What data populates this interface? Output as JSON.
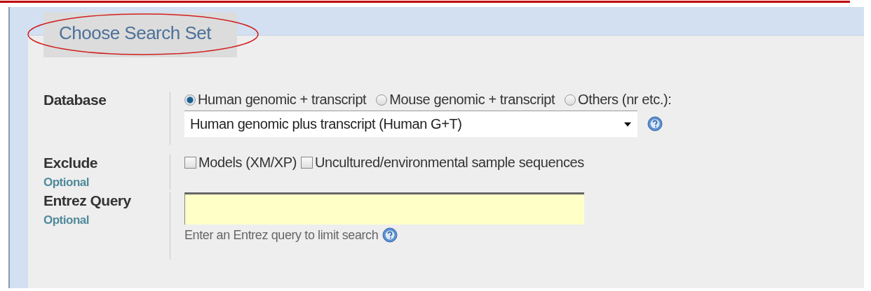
{
  "section": {
    "title": "Choose Search Set",
    "title_circled": true
  },
  "rows": [
    {
      "kind": "radios",
      "label": "Database",
      "options": [
        {
          "label": "Human genomic + transcript",
          "selected": true
        },
        {
          "label": "Mouse genomic + transcript",
          "selected": false
        },
        {
          "label": "Others (nr etc.):",
          "selected": false
        }
      ],
      "select": {
        "value": "Human genomic plus transcript (Human G+T)"
      }
    },
    {
      "kind": "checkboxes",
      "label": "Exclude",
      "hint": "Optional",
      "options": [
        {
          "label": "Models (XM/XP)",
          "checked": false
        },
        {
          "label": "Uncultured/environmental sample sequences",
          "checked": false
        }
      ]
    },
    {
      "kind": "text",
      "label": "Entrez Query",
      "hint": "Optional",
      "value": "",
      "help": "Enter an Entrez query to limit search"
    }
  ]
}
